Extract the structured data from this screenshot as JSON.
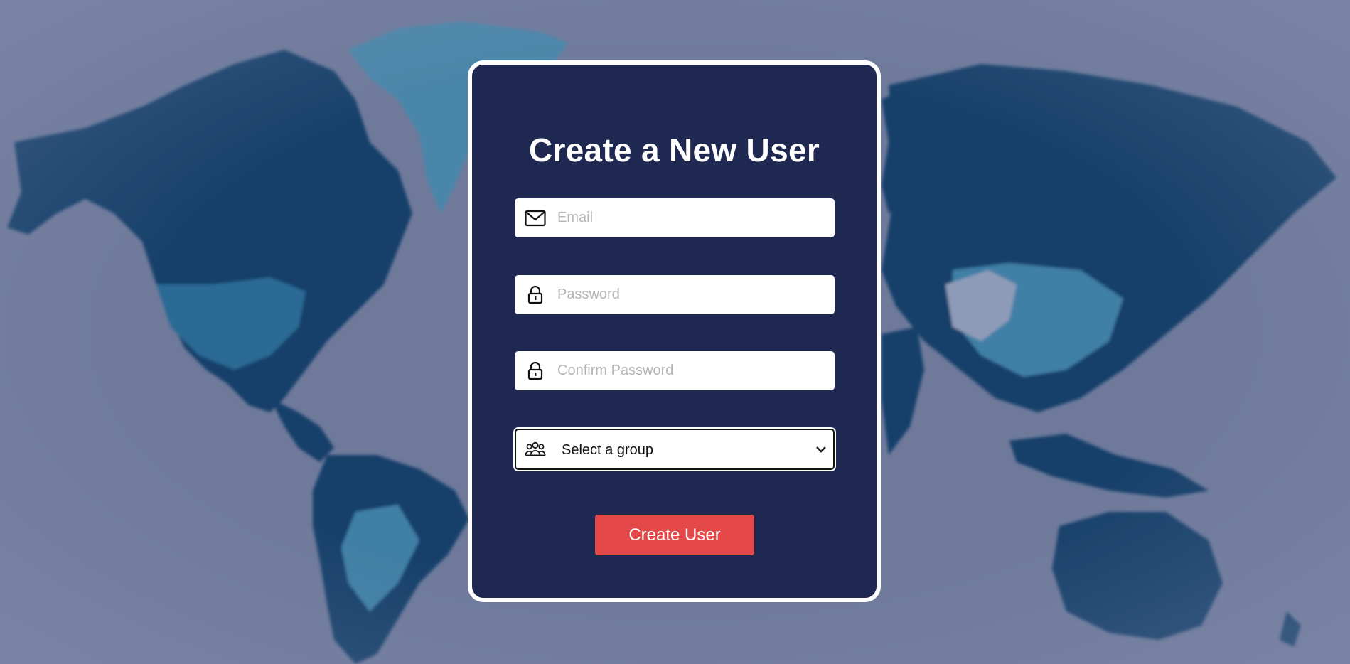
{
  "page": {
    "background_color": "#6f7a9b",
    "card_color": "#1f2850",
    "accent_color": "#e54848"
  },
  "form": {
    "title": "Create a New User",
    "email": {
      "placeholder": "Email",
      "value": "",
      "icon": "mail-icon"
    },
    "password": {
      "placeholder": "Password",
      "value": "",
      "icon": "lock-icon"
    },
    "confirm_password": {
      "placeholder": "Confirm Password",
      "value": "",
      "icon": "lock-icon"
    },
    "group": {
      "selected": "Select a group",
      "icon": "group-icon"
    },
    "submit_label": "Create User"
  }
}
